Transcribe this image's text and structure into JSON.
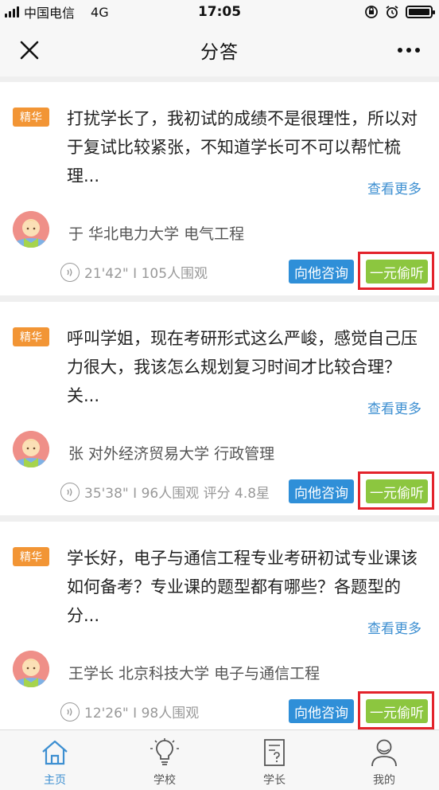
{
  "status_bar": {
    "carrier": "中国电信",
    "network": "4G",
    "time": "17:05",
    "icons": [
      "signal-icon",
      "orientation-lock-icon",
      "alarm-icon",
      "battery-icon"
    ]
  },
  "nav": {
    "title": "分答",
    "close_icon": "close-icon",
    "more_icon": "more-dots-icon"
  },
  "cards": [
    {
      "tag": "精华",
      "question": "打扰学长了，我初试的成绩不是很理性，所以对于复试比较紧张，不知道学长可不可以帮忙梳理...",
      "more": "查看更多",
      "author": "于 华北电力大学 电气工程",
      "meta": "21'42\" I 105人围观",
      "consult_label": "向他咨询",
      "listen_label": "一元偷听"
    },
    {
      "tag": "精华",
      "question": "呼叫学姐，现在考研形式这么严峻，感觉自己压力很大，我该怎么规划复习时间才比较合理？关...",
      "more": "查看更多",
      "author": "张 对外经济贸易大学 行政管理",
      "meta": "35'38\" I 96人围观 评分 4.8星",
      "consult_label": "向他咨询",
      "listen_label": "一元偷听"
    },
    {
      "tag": "精华",
      "question": "学长好，电子与通信工程专业考研初试专业课该如何备考？专业课的题型都有哪些？各题型的分...",
      "more": "查看更多",
      "author": "王学长 北京科技大学 电子与通信工程",
      "meta": "12'26\" I 98人围观",
      "consult_label": "向他咨询",
      "listen_label": "一元偷听"
    }
  ],
  "tabbar": {
    "tabs": [
      {
        "label": "主页",
        "icon": "home-icon",
        "active": true
      },
      {
        "label": "学校",
        "icon": "lightbulb-icon",
        "active": false
      },
      {
        "label": "学长",
        "icon": "question-doc-icon",
        "active": false
      },
      {
        "label": "我的",
        "icon": "user-icon",
        "active": false
      }
    ]
  },
  "colors": {
    "accent": "#3d8fd1",
    "tag": "#f29535",
    "consult_button": "#2f8fd8",
    "listen_button": "#8cc63f",
    "highlight_frame": "#e3232b"
  }
}
